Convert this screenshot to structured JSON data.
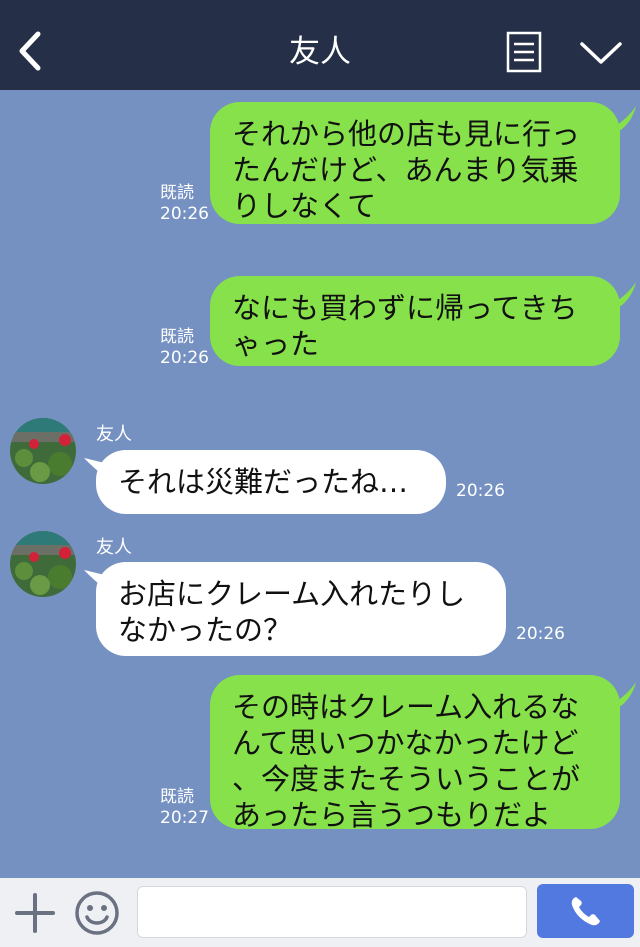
{
  "header": {
    "title": "友人",
    "back_icon": "chevron-left-icon",
    "menu_icon": "document-list-icon",
    "collapse_icon": "chevron-down-icon"
  },
  "messages": [
    {
      "side": "out",
      "text": "それから他の店も見に行っ\nたんだけど、あんまり気乗\nりしなくて",
      "read": "既読",
      "time": "20:26"
    },
    {
      "side": "out",
      "text": "なにも買わずに帰ってきち\nゃった",
      "read": "既読",
      "time": "20:26"
    },
    {
      "side": "in",
      "sender": "友人",
      "text": "それは災難だったね…",
      "time": "20:26"
    },
    {
      "side": "in",
      "sender": "友人",
      "text": "お店にクレーム入れたりし\nなかったの？",
      "time": "20:26"
    },
    {
      "side": "out",
      "text": "その時はクレーム入れるな\nんて思いつかなかったけど\n、今度またそういうことが\nあったら言うつもりだよ",
      "read": "既読",
      "time": "20:27"
    }
  ],
  "footer": {
    "plus_icon": "plus-icon",
    "emoji_icon": "smiley-icon",
    "input_value": "",
    "call_icon": "phone-icon"
  },
  "colors": {
    "header_bg": "#252f47",
    "chat_bg": "#7591c2",
    "outgoing_bubble": "#86e14b",
    "incoming_bubble": "#ffffff",
    "call_button": "#5279df"
  }
}
